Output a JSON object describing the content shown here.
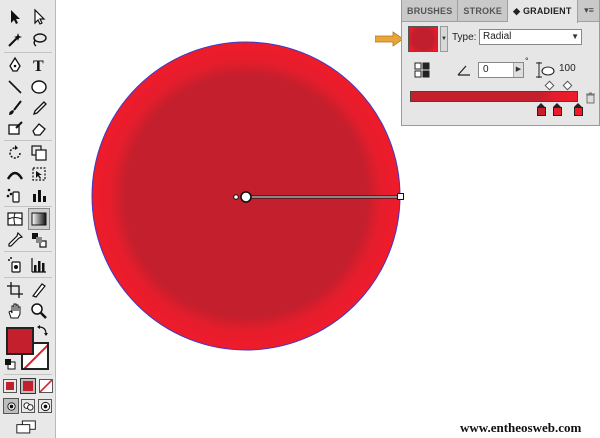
{
  "tools_panel": {
    "tools": [
      {
        "name": "selection-tool-icon"
      },
      {
        "name": "direct-selection-tool-icon"
      },
      {
        "name": "magic-wand-tool-icon"
      },
      {
        "name": "lasso-tool-icon"
      },
      {
        "name": "pen-tool-icon"
      },
      {
        "name": "type-tool-icon"
      },
      {
        "name": "line-segment-tool-icon"
      },
      {
        "name": "ellipse-tool-icon"
      },
      {
        "name": "paintbrush-tool-icon"
      },
      {
        "name": "pencil-tool-icon"
      },
      {
        "name": "blob-brush-tool-icon"
      },
      {
        "name": "eraser-tool-icon"
      },
      {
        "name": "rotate-tool-icon"
      },
      {
        "name": "scale-tool-icon"
      },
      {
        "name": "width-tool-icon"
      },
      {
        "name": "free-transform-tool-icon"
      },
      {
        "name": "symbol-sprayer-tool-icon"
      },
      {
        "name": "column-graph-tool-icon"
      },
      {
        "name": "mesh-tool-icon"
      },
      {
        "name": "gradient-tool-icon"
      },
      {
        "name": "eyedropper-tool-icon"
      },
      {
        "name": "blend-tool-icon"
      },
      {
        "name": "symbol-sprayer-alt-icon"
      },
      {
        "name": "graph-tool-icon"
      },
      {
        "name": "artboard-tool-icon"
      },
      {
        "name": "slice-tool-icon"
      },
      {
        "name": "hand-tool-icon"
      },
      {
        "name": "zoom-tool-icon"
      }
    ],
    "active_tool": "gradient-tool-icon",
    "fill_color": "#c41f2d",
    "stroke_color": "none"
  },
  "gradient_panel": {
    "tabs": [
      {
        "label": "BRUSHES"
      },
      {
        "label": "STROKE"
      },
      {
        "label": "◆ GRADIENT"
      }
    ],
    "active_tab": "◆ GRADIENT",
    "type_label": "Type:",
    "type_value": "Radial",
    "angle_value": "0",
    "degree_symbol": "°",
    "aspect_value": "100",
    "stops": [
      {
        "color": "#c31f2d",
        "location_percent": 78
      },
      {
        "color": "#e61d2c",
        "location_percent": 88
      },
      {
        "color": "#ef1b2b",
        "location_percent": 100
      }
    ],
    "midpoints_percent": [
      83,
      94
    ],
    "colors": {
      "center": "#c11f2e",
      "outer": "#ef1b2b",
      "pointer": "#e8a63a"
    }
  },
  "artwork": {
    "shape": "circle",
    "gradient_type": "radial",
    "selection_color": "#3b3bcf"
  },
  "watermark": {
    "text": "www.entheosweb.com"
  }
}
